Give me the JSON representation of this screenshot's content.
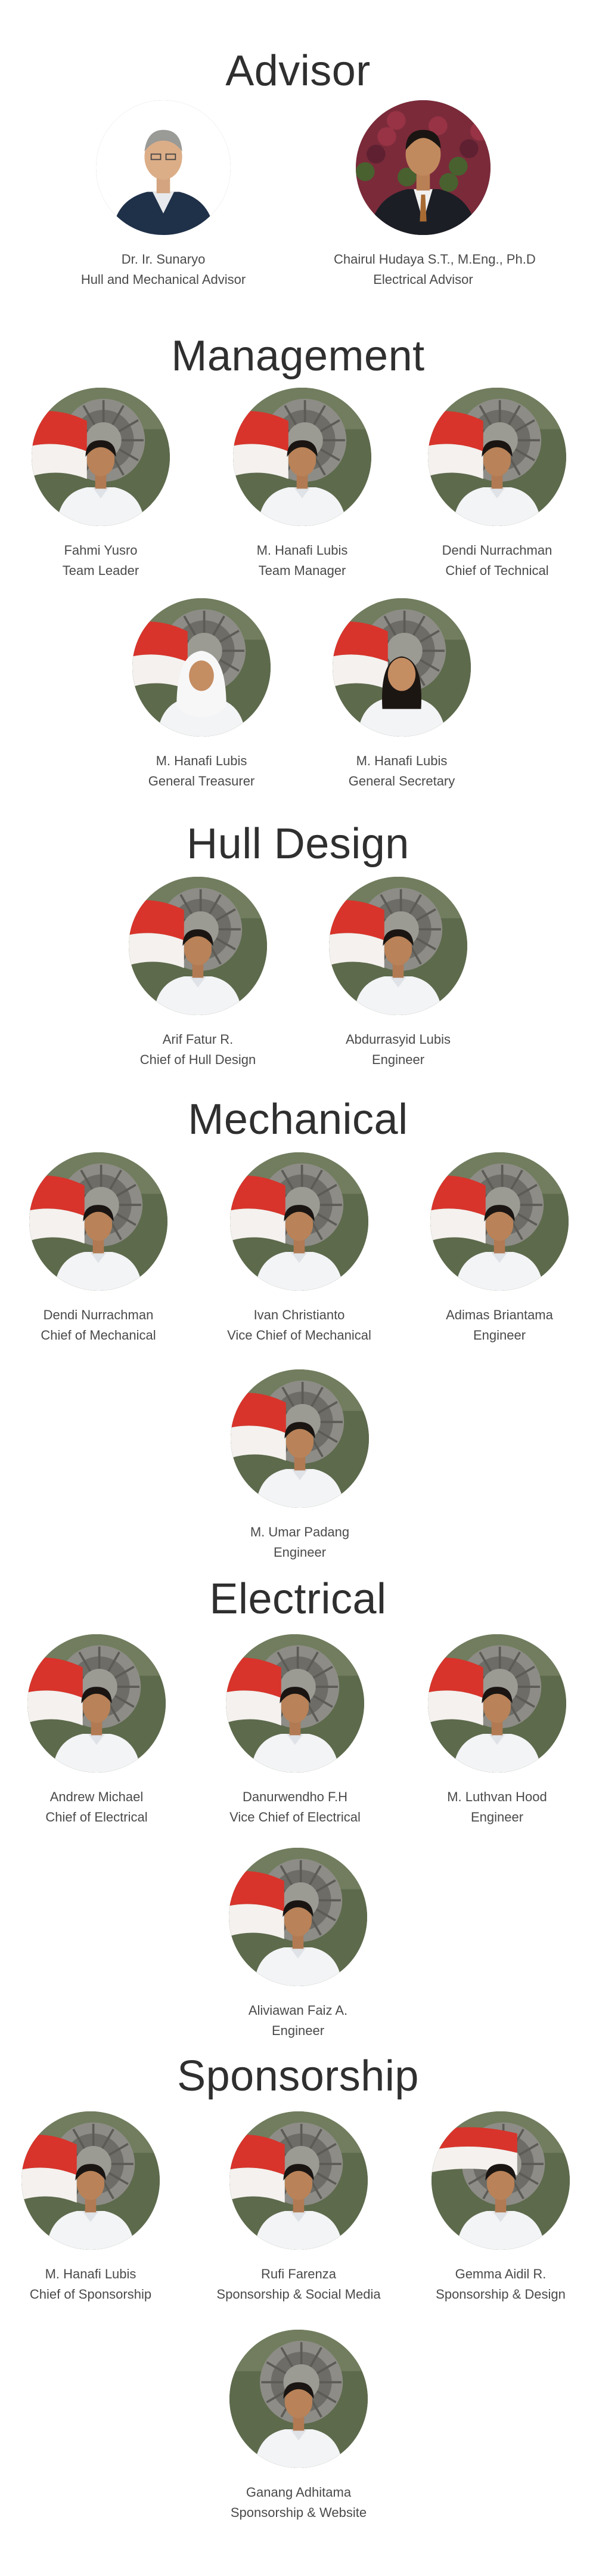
{
  "sections": {
    "advisor": {
      "title": "Advisor",
      "members": [
        {
          "name": "Dr. Ir. Sunaryo",
          "role": "Hull and Mechanical Advisor"
        },
        {
          "name": "Chairul Hudaya S.T., M.Eng., Ph.D",
          "role": "Electrical Advisor"
        }
      ]
    },
    "management": {
      "title": "Management",
      "members": [
        {
          "name": "Fahmi Yusro",
          "role": "Team Leader"
        },
        {
          "name": "M. Hanafi Lubis",
          "role": "Team Manager"
        },
        {
          "name": "Dendi Nurrachman",
          "role": "Chief of Technical"
        },
        {
          "name": "M. Hanafi Lubis",
          "role": "General Treasurer"
        },
        {
          "name": "M. Hanafi Lubis",
          "role": "General Secretary"
        }
      ]
    },
    "hull_design": {
      "title": "Hull Design",
      "members": [
        {
          "name": "Arif Fatur R.",
          "role": "Chief of Hull Design"
        },
        {
          "name": "Abdurrasyid Lubis",
          "role": "Engineer"
        }
      ]
    },
    "mechanical": {
      "title": "Mechanical",
      "members": [
        {
          "name": "Dendi Nurrachman",
          "role": "Chief of Mechanical"
        },
        {
          "name": "Ivan Christianto",
          "role": "Vice Chief of Mechanical"
        },
        {
          "name": "Adimas Briantama",
          "role": "Engineer"
        },
        {
          "name": "M. Umar Padang",
          "role": "Engineer"
        }
      ]
    },
    "electrical": {
      "title": "Electrical",
      "members": [
        {
          "name": "Andrew Michael",
          "role": "Chief of Electrical"
        },
        {
          "name": "Danurwendho F.H",
          "role": "Vice Chief of Electrical"
        },
        {
          "name": "M. Luthvan Hood",
          "role": "Engineer"
        },
        {
          "name": "Aliviawan Faiz A.",
          "role": "Engineer"
        }
      ]
    },
    "sponsorship": {
      "title": "Sponsorship",
      "members": [
        {
          "name": "M. Hanafi Lubis",
          "role": "Chief of Sponsorship"
        },
        {
          "name": "Rufi Farenza",
          "role": "Sponsorship & Social Media"
        },
        {
          "name": "Gemma Aidil R.",
          "role": "Sponsorship & Design"
        },
        {
          "name": "Ganang Adhitama",
          "role": "Sponsorship & Website"
        }
      ]
    }
  },
  "colors": {
    "flag_red": "#d8342b",
    "flag_white": "#f4f1ee",
    "shirt": "#f3f4f6",
    "background_foliage": "#5d6a4c",
    "text": "#4a4a4a",
    "title": "#2f2f2f"
  }
}
